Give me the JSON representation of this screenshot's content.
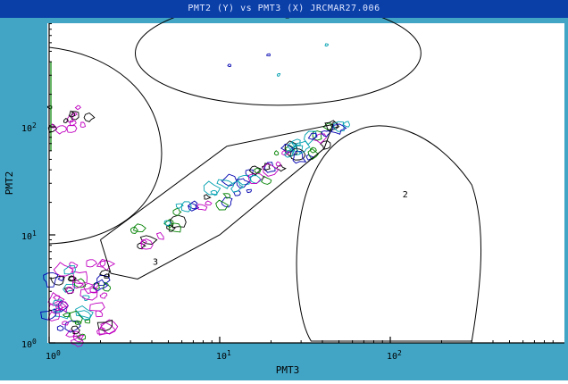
{
  "window": {
    "title": "PMT2 (Y) vs PMT3 (X) JRCMAR27.006"
  },
  "chart_data": {
    "type": "contour",
    "xlabel": "PMT3",
    "ylabel": "PMT2",
    "x_scale": "log",
    "y_scale": "log",
    "xlim": [
      1,
      460
    ],
    "ylim": [
      1,
      1000
    ],
    "x_ticks": [
      {
        "value": 1,
        "label": "10^0"
      },
      {
        "value": 10,
        "label": "10^1"
      },
      {
        "value": 100,
        "label": "10^2"
      }
    ],
    "y_ticks": [
      {
        "value": 1,
        "label": "10^0"
      },
      {
        "value": 10,
        "label": "10^1"
      },
      {
        "value": 100,
        "label": "10^2"
      }
    ],
    "regions": [
      {
        "label": "1",
        "shape": "ellipse",
        "center": [
          22,
          480
        ],
        "rx_decades": 0.91,
        "ry_decades": 0.43
      },
      {
        "label": "2",
        "shape": "arch",
        "x_range": [
          27,
          360
        ],
        "y_range": [
          1,
          110
        ]
      },
      {
        "label": "3",
        "shape": "polygon",
        "vertices": [
          [
            2.0,
            9
          ],
          [
            11,
            66
          ],
          [
            46,
            105
          ],
          [
            41,
            63
          ],
          [
            10,
            10
          ],
          [
            3.3,
            3.9
          ],
          [
            2.3,
            4.4
          ],
          [
            2.0,
            9
          ]
        ]
      }
    ],
    "contour_colors": [
      "#c000c0",
      "#008000",
      "#0000b0",
      "#00a0b0",
      "#000000"
    ]
  }
}
